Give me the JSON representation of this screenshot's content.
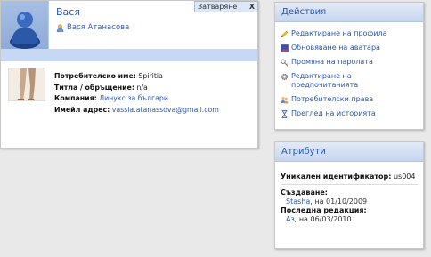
{
  "profile": {
    "name": "Вася",
    "user_link": "Вася Атанасова",
    "close_label": "Затваряне",
    "close_x": "X",
    "details": {
      "username_label": "Потребителско име:",
      "username": "Spiritia",
      "title_label": "Титла / обръщение:",
      "title": "n/a",
      "company_label": "Компания:",
      "company": "Линукс за българи",
      "email_label": "Имейл адрес:",
      "email": "vassia.atanassova@gmail.com"
    }
  },
  "actions": {
    "title": "Действия",
    "items": [
      {
        "label": "Редактиране на профила",
        "icon": "pencil-icon"
      },
      {
        "label": "Обновяване на аватара",
        "icon": "picture-icon"
      },
      {
        "label": "Промяна на паролата",
        "icon": "key-icon"
      },
      {
        "label": "Редактиране на предпочитанията",
        "icon": "gear-icon"
      },
      {
        "label": "Потребителски права",
        "icon": "users-icon"
      },
      {
        "label": "Преглед на историята",
        "icon": "hourglass-icon"
      }
    ]
  },
  "attributes": {
    "title": "Атрибути",
    "uid_label": "Уникален идентификатор:",
    "uid": "us004",
    "created_label": "Създаване:",
    "created_by": "Stasha",
    "created_on": ", на 01/10/2009",
    "edited_label": "Последна редакция:",
    "edited_by": "Аз",
    "edited_on": ", на 06/03/2010"
  }
}
